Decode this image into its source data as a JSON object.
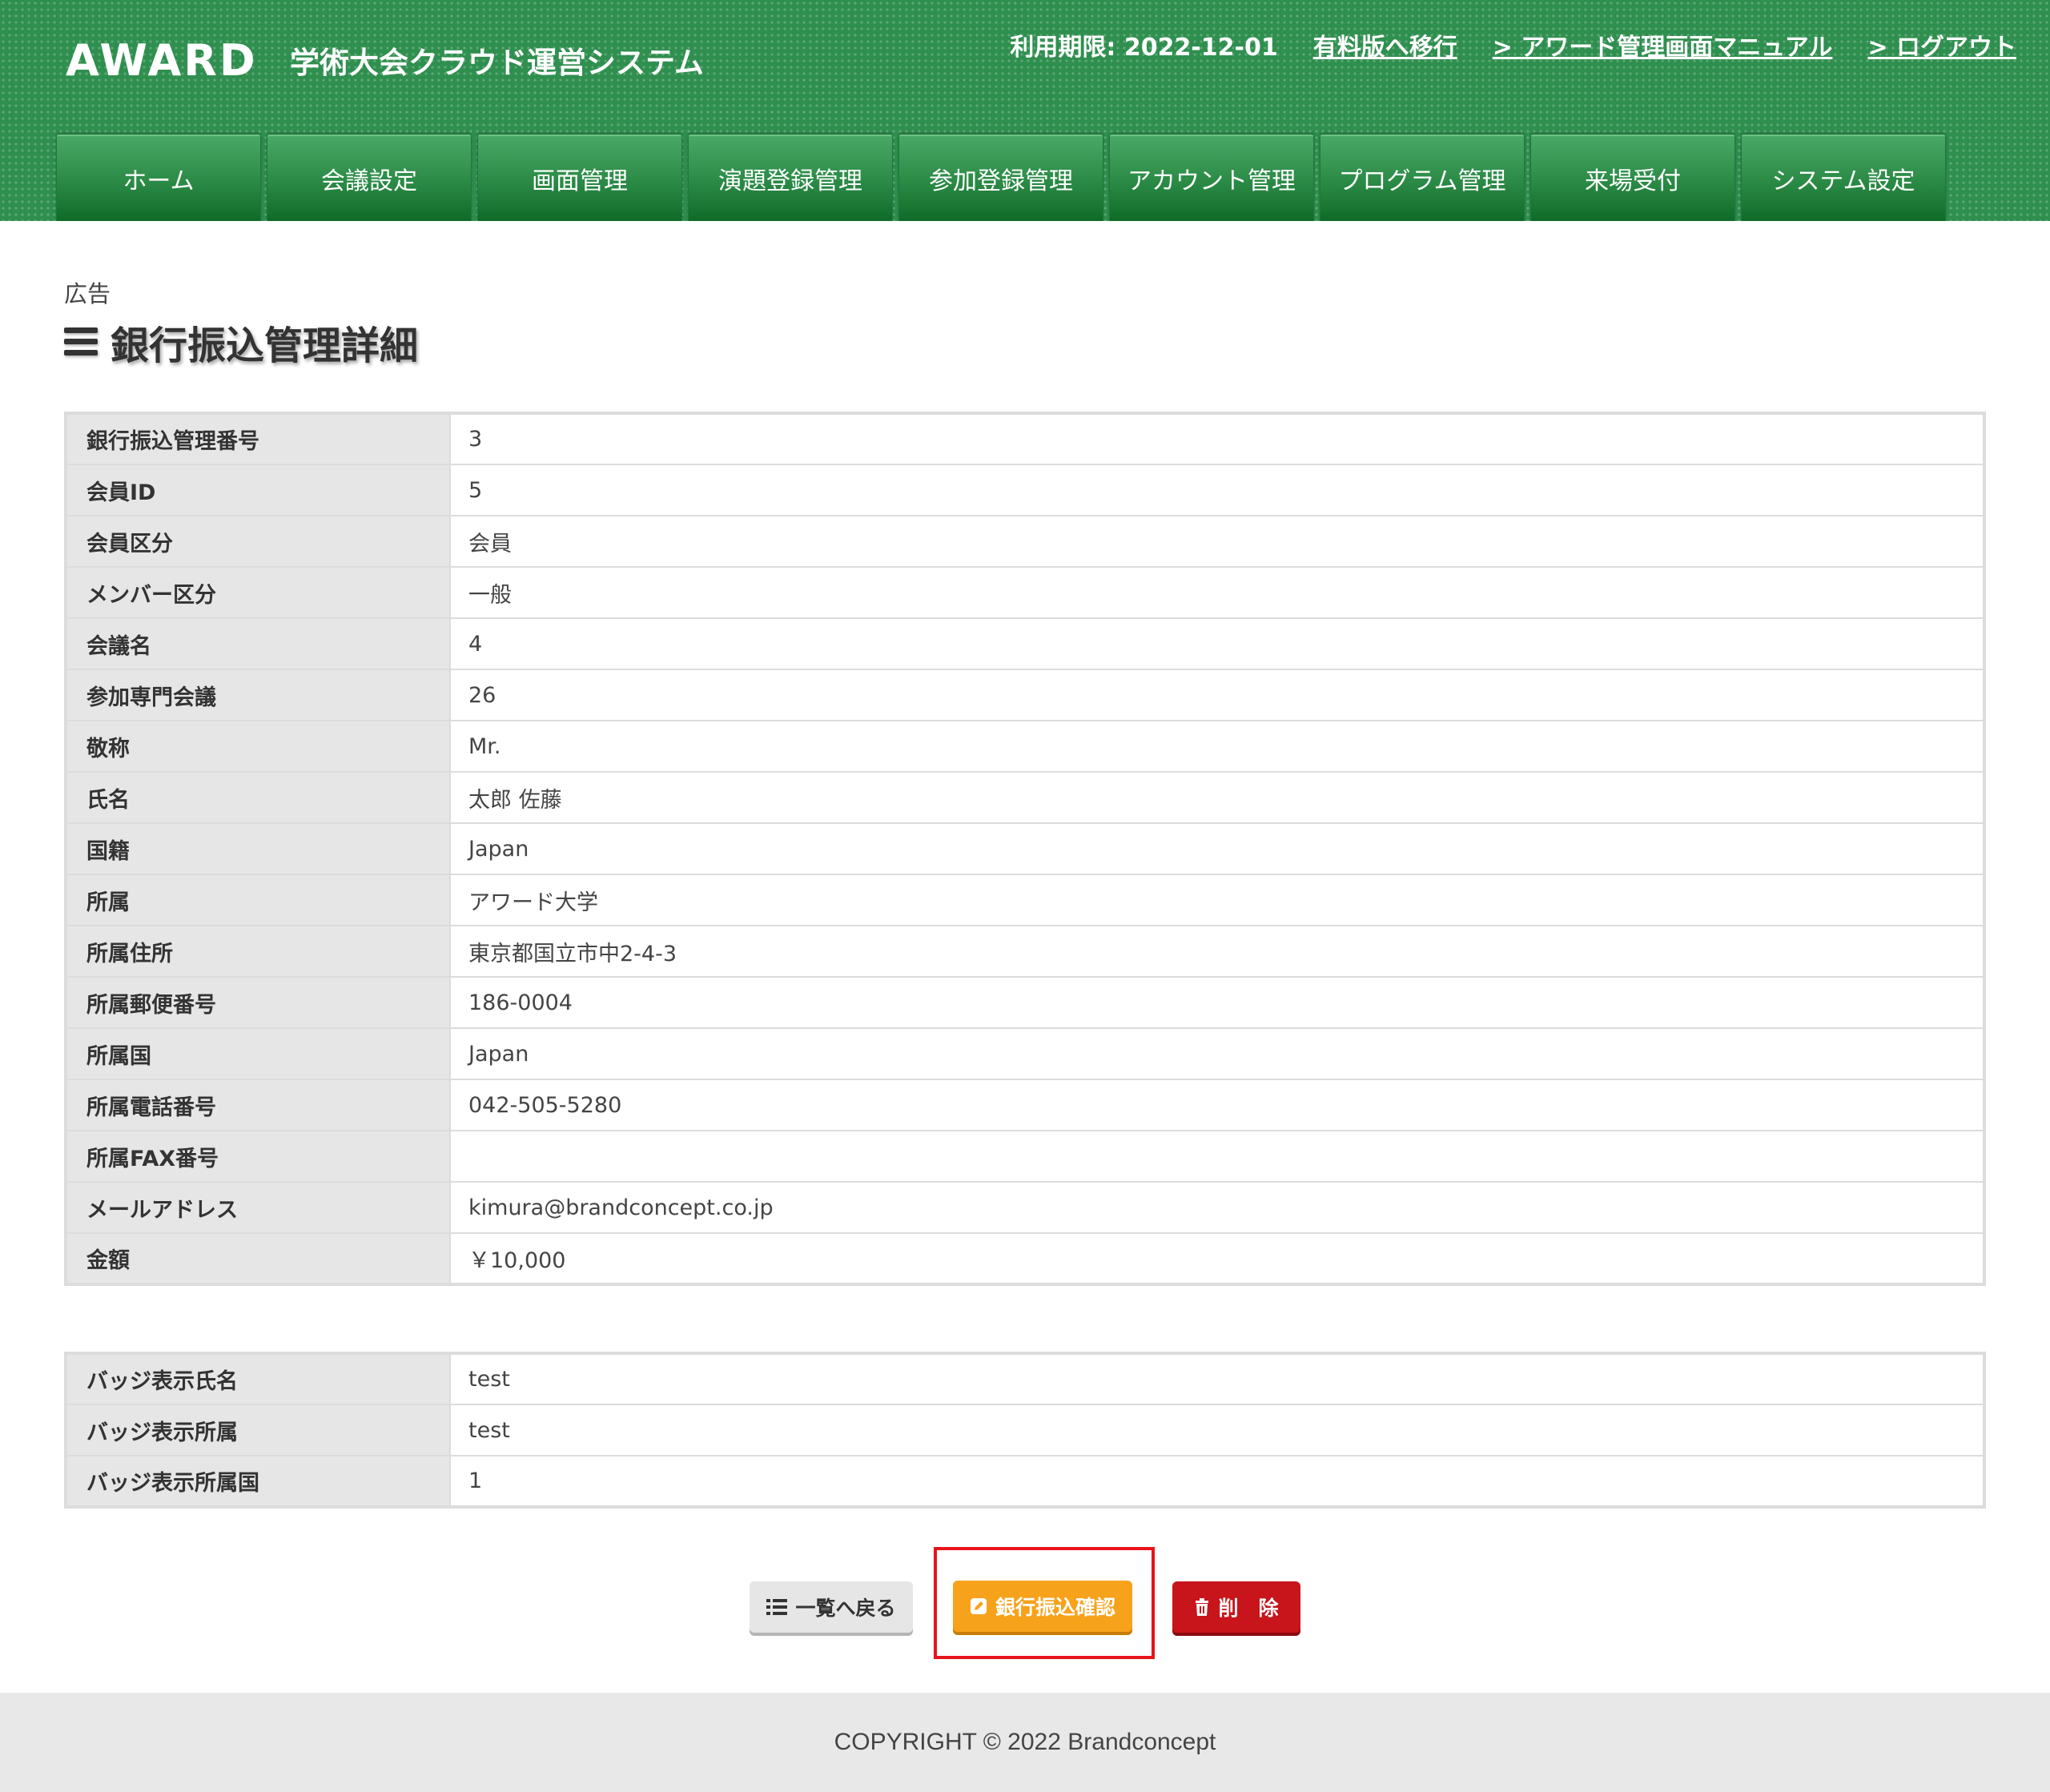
{
  "header": {
    "logo": "AWARD",
    "system_name": "学術大会クラウド運営システム",
    "expiry": "利用期限: 2022-12-01",
    "links": {
      "upgrade": "有料版へ移行",
      "manual": "> アワード管理画面マニュアル",
      "logout": "> ログアウト"
    },
    "brand_color": "#2f8f4f"
  },
  "nav": {
    "tabs": [
      "ホーム",
      "会議設定",
      "画面管理",
      "演題登録管理",
      "参加登録管理",
      "アカウント管理",
      "プログラム管理",
      "来場受付",
      "システム設定"
    ]
  },
  "page": {
    "breadcrumb": "広告",
    "title": "銀行振込管理詳細",
    "title_icon": "menu-icon"
  },
  "detail": {
    "rows": [
      {
        "label": "銀行振込管理番号",
        "value": "3"
      },
      {
        "label": "会員ID",
        "value": "5"
      },
      {
        "label": "会員区分",
        "value": "会員"
      },
      {
        "label": "メンバー区分",
        "value": "一般"
      },
      {
        "label": "会議名",
        "value": "4"
      },
      {
        "label": "参加専門会議",
        "value": "26"
      },
      {
        "label": "敬称",
        "value": "Mr."
      },
      {
        "label": "氏名",
        "value": "太郎 佐藤"
      },
      {
        "label": "国籍",
        "value": "Japan"
      },
      {
        "label": "所属",
        "value": "アワード大学"
      },
      {
        "label": "所属住所",
        "value": "東京都国立市中2-4-3"
      },
      {
        "label": "所属郵便番号",
        "value": "186-0004"
      },
      {
        "label": "所属国",
        "value": "Japan"
      },
      {
        "label": "所属電話番号",
        "value": "042-505-5280"
      },
      {
        "label": "所属FAX番号",
        "value": ""
      },
      {
        "label": "メールアドレス",
        "value": "kimura@brandconcept.co.jp"
      },
      {
        "label": "金額",
        "value": "￥10,000"
      }
    ]
  },
  "badge": {
    "rows": [
      {
        "label": "バッジ表示氏名",
        "value": "test"
      },
      {
        "label": "バッジ表示所属",
        "value": "test"
      },
      {
        "label": "バッジ表示所属国",
        "value": "1"
      }
    ]
  },
  "actions": {
    "back": {
      "label": "一覧へ戻る",
      "icon": "list-icon"
    },
    "confirm": {
      "label": "銀行振込確認",
      "icon": "edit-icon",
      "color": "#f7a21b"
    },
    "delete": {
      "label": "削　除",
      "icon": "trash-icon",
      "color": "#c8141b"
    }
  },
  "footer": {
    "copyright": "COPYRIGHT © 2022 Brandconcept"
  }
}
